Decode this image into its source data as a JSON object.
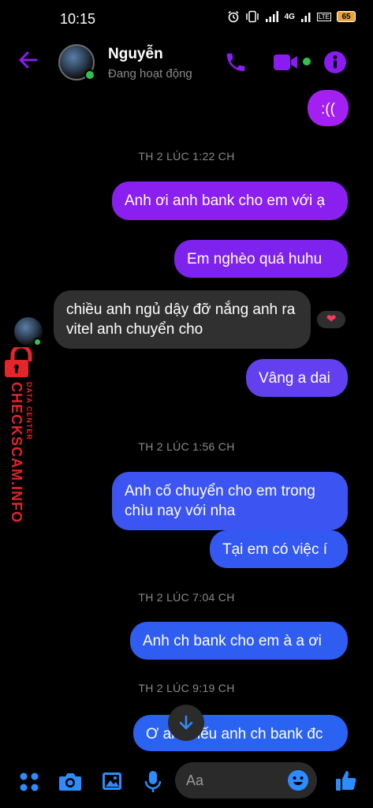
{
  "status_bar": {
    "time": "10:15",
    "network": "4G",
    "volte": "LTE",
    "battery": "65"
  },
  "header": {
    "name": "Nguyễn",
    "status": "Đang hoạt động"
  },
  "colors": {
    "accent": "#8a1cf2",
    "online": "#31c24d",
    "bubble_in": "#303030",
    "bubble_purple": "#8a1ff0",
    "bubble_blue": "#2f5df2"
  },
  "messages": [
    {
      "text": ":((",
      "side": "out"
    },
    {
      "text": "Anh ơi anh bank cho em với ạ",
      "side": "out"
    },
    {
      "text": "Em  nghèo quá huhu",
      "side": "out"
    },
    {
      "text": "chiều anh ngủ dậy đỡ nắng anh ra vitel anh chuyển cho",
      "side": "in"
    },
    {
      "text": "Vâng a dai",
      "side": "out",
      "reaction": "heart"
    },
    {
      "text": "Anh cố chuyển cho em trong chìu nay với nha",
      "side": "out"
    },
    {
      "text": "Tại em có việc í",
      "side": "out"
    },
    {
      "text": "Anh ch bank cho em à a ơi",
      "side": "out"
    },
    {
      "text": "Ơ anh nếu anh ch bank đc",
      "side": "out"
    }
  ],
  "timestamps": [
    "TH 2 LÚC 1:22 CH",
    "TH 2 LÚC 1:56 CH",
    "TH 2 LÚC 7:04 CH",
    "TH 2 LÚC 9:19 CH"
  ],
  "watermark": {
    "brand": "CHECKSCAM.INFO",
    "tagline": "DATA CENTER"
  },
  "compose": {
    "placeholder": "Aa"
  }
}
